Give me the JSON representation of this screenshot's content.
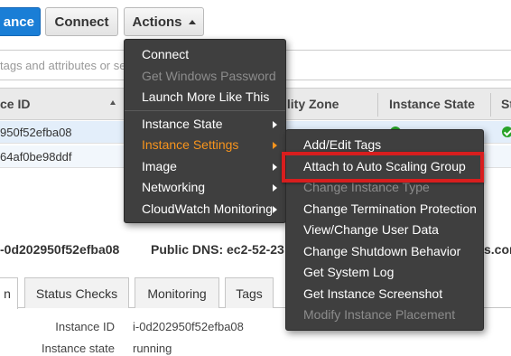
{
  "toolbar": {
    "launch_label": "ance",
    "connect_label": "Connect",
    "actions_label": "Actions"
  },
  "search": {
    "placeholder_text": "tags and attributes or se"
  },
  "table": {
    "columns": [
      "ce ID",
      "ility Zone",
      "Instance State",
      "St"
    ],
    "rows": [
      {
        "instance_id": "950f52efba08"
      },
      {
        "instance_id": "64af0be98ddf"
      }
    ]
  },
  "detail": {
    "instance_label": "-0d202950f52efba08",
    "public_dns": "Public DNS: ec2-52-23",
    "dns_suffix": "s.com",
    "tabs": [
      "n",
      "Status Checks",
      "Monitoring",
      "Tags"
    ],
    "fields": [
      {
        "label": "Instance ID",
        "value": "i-0d202950f52efba08"
      },
      {
        "label": "Instance state",
        "value": "running"
      }
    ]
  },
  "actions_menu": {
    "items": [
      {
        "label": "Connect",
        "disabled": false
      },
      {
        "label": "Get Windows Password",
        "disabled": true
      },
      {
        "label": "Launch More Like This",
        "disabled": false
      },
      {
        "label": "Instance State",
        "submenu": true
      },
      {
        "label": "Instance Settings",
        "submenu": true,
        "highlighted": true
      },
      {
        "label": "Image",
        "submenu": true
      },
      {
        "label": "Networking",
        "submenu": true
      },
      {
        "label": "CloudWatch Monitoring",
        "submenu": true
      }
    ]
  },
  "settings_menu": {
    "items": [
      {
        "label": "Add/Edit Tags",
        "disabled": false
      },
      {
        "label": "Attach to Auto Scaling Group",
        "disabled": false,
        "outlined": true
      },
      {
        "label": "Change Instance Type",
        "disabled": true
      },
      {
        "label": "Change Termination Protection",
        "disabled": false
      },
      {
        "label": "View/Change User Data",
        "disabled": false
      },
      {
        "label": "Change Shutdown Behavior",
        "disabled": false
      },
      {
        "label": "Get System Log",
        "disabled": false
      },
      {
        "label": "Get Instance Screenshot",
        "disabled": false
      },
      {
        "label": "Modify Instance Placement",
        "disabled": true
      }
    ]
  },
  "colors": {
    "primary_button": "#1a7ed6",
    "menu_background": "#3f3f3f",
    "menu_highlight_text": "#f7941d",
    "outline": "#d81e1e",
    "status_ok": "#29a329"
  }
}
